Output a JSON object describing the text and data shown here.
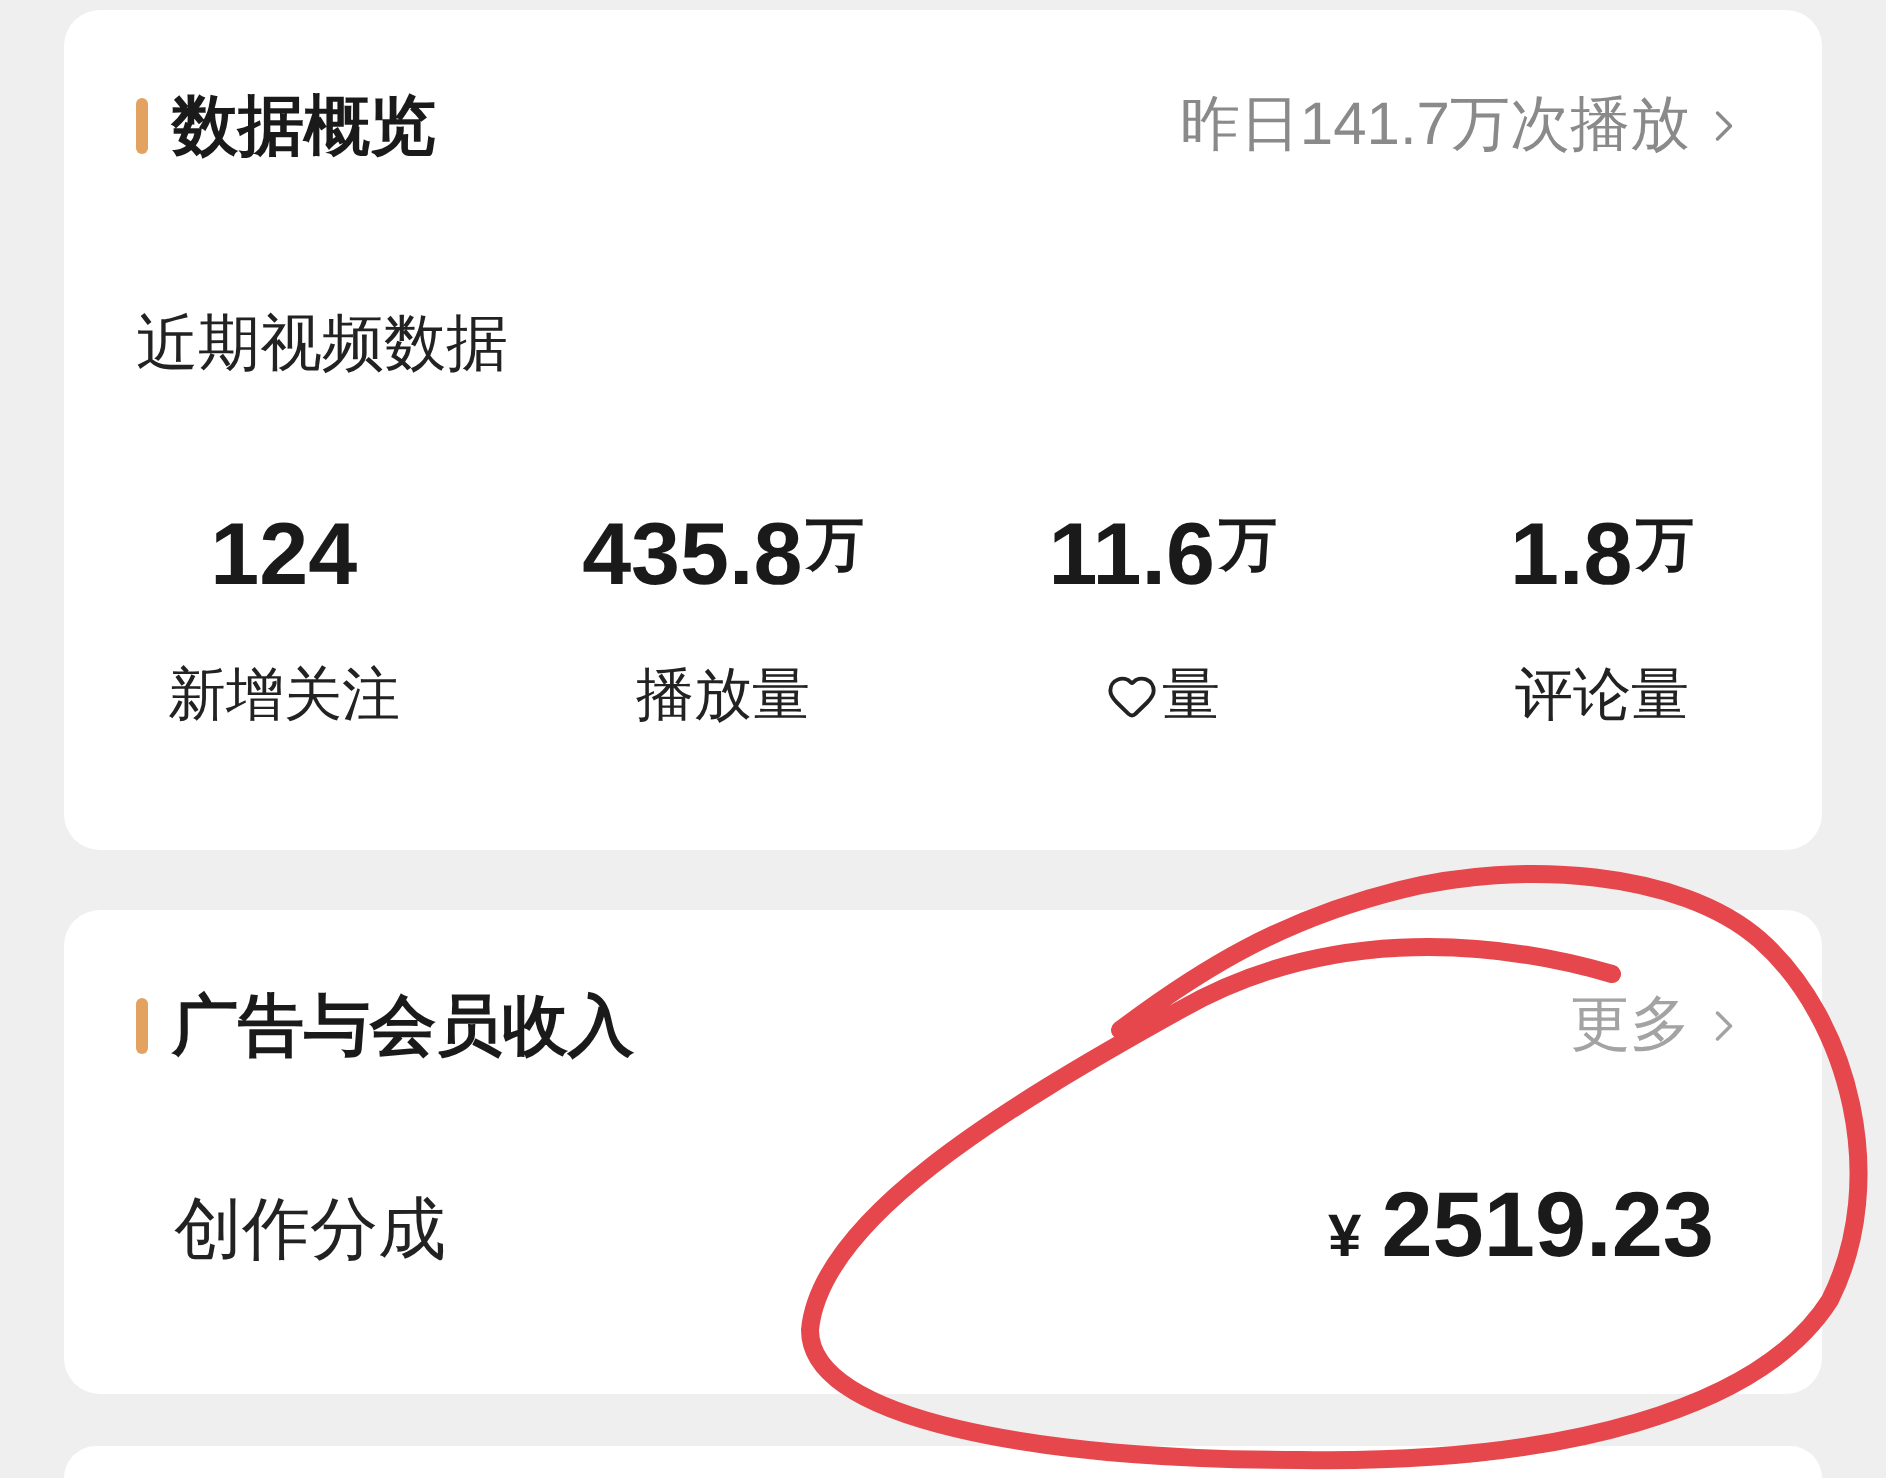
{
  "overview": {
    "title": "数据概览",
    "link": "昨日141.7万次播放",
    "subtitle": "近期视频数据",
    "stats": [
      {
        "kind": "plain",
        "value": "124",
        "label": "新增关注"
      },
      {
        "kind": "plain",
        "value": "435.8",
        "unit": "万",
        "label": "播放量"
      },
      {
        "kind": "heart",
        "value": "11.6",
        "unit": "万",
        "label": "量"
      },
      {
        "kind": "plain",
        "value": "1.8",
        "unit": "万",
        "label": "评论量"
      }
    ]
  },
  "income": {
    "title": "广告与会员收入",
    "link": "更多",
    "rows": [
      {
        "label": "创作分成",
        "currency": "¥",
        "amount": "2519.23"
      }
    ]
  }
}
